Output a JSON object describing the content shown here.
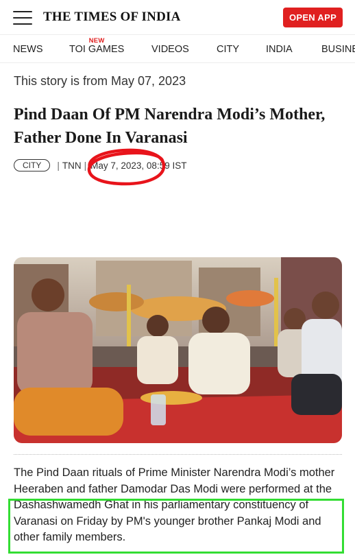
{
  "header": {
    "logo": "THE TIMES OF INDIA",
    "open_app_label": "OPEN APP",
    "menu_icon": "hamburger-icon",
    "accent_color": "#e02020"
  },
  "nav": {
    "items": [
      {
        "label": "NEWS"
      },
      {
        "label": "TOI GAMES",
        "badge": "NEW"
      },
      {
        "label": "VIDEOS"
      },
      {
        "label": "CITY"
      },
      {
        "label": "INDIA"
      },
      {
        "label": "BUSINE"
      }
    ]
  },
  "article": {
    "story_date": "This story is from May 07, 2023",
    "headline": "Pind Daan Of PM Narendra Modi’s Mother, Father Done In Varanasi",
    "meta": {
      "city_tag": "CITY",
      "separator": "|",
      "source": "TNN",
      "datetime": "May 7, 2023, 08:59 IST"
    },
    "body_line_1": "The Pind Daan rituals of Prime Minister Narendra Modi’s mother Heeraben and father Damodar Das Modi were",
    "body_line_2": "performed at the Dashashwamedh Ghat in his parliamentary constituency of Varanasi on Friday by PM's younger brother Pankaj Modi and other family members."
  },
  "annotations": {
    "red_circle_color": "#e8141b",
    "green_box_color": "#33dd33"
  }
}
